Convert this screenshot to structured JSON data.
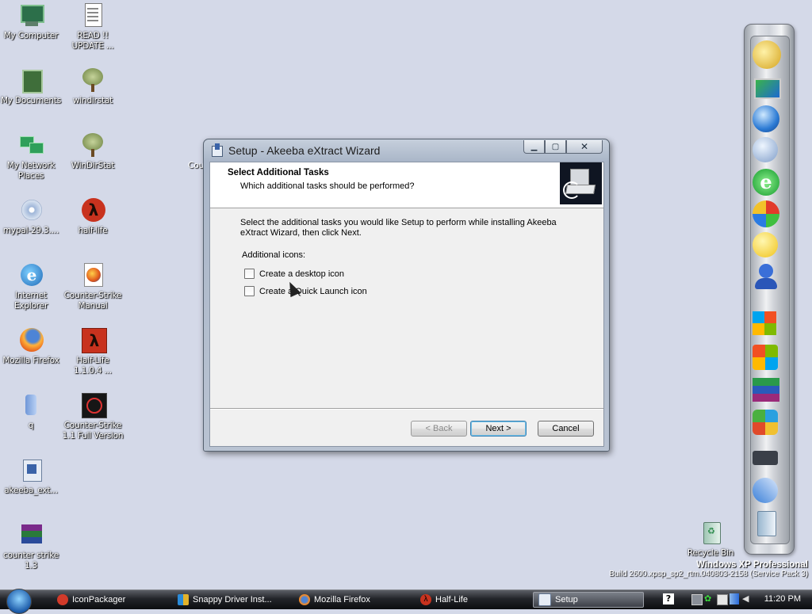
{
  "desktop": {
    "icons": [
      {
        "label": "My Computer"
      },
      {
        "label": "READ !! UPDATE ..."
      },
      {
        "label": "My Documents"
      },
      {
        "label": "windirstat"
      },
      {
        "label": "My Network Places"
      },
      {
        "label": "WinDirStat"
      },
      {
        "label": "mypal-29.3...."
      },
      {
        "label": "half-life"
      },
      {
        "label": "Internet Explorer"
      },
      {
        "label": "Counter-Strike Manual"
      },
      {
        "label": "Mozilla Firefox"
      },
      {
        "label": "Half-Life 1.1.0.4 ..."
      },
      {
        "label": "q"
      },
      {
        "label": "Counter-Strike 1.1 Full Version"
      },
      {
        "label": "akeeba_ext..."
      },
      {
        "label": "counter strike 1.3"
      },
      {
        "label": "Recycle Bin"
      }
    ],
    "partial_label": "Cou"
  },
  "window": {
    "title": "Setup - Akeeba eXtract Wizard",
    "header_title": "Select Additional Tasks",
    "header_subtitle": "Which additional tasks should be performed?",
    "intro": "Select the additional tasks you would like Setup to perform while installing Akeeba eXtract Wizard, then click Next.",
    "group_label": "Additional icons:",
    "tasks": [
      {
        "label": "Create a desktop icon",
        "checked": false
      },
      {
        "label": "Create a Quick Launch icon",
        "checked": false
      }
    ],
    "buttons": {
      "back": "< Back",
      "next": "Next >",
      "cancel": "Cancel"
    }
  },
  "taskbar": {
    "items": [
      {
        "label": "IconPackager",
        "icon": "iconpackager-icon"
      },
      {
        "label": "Snappy Driver Inst...",
        "icon": "snappy-icon"
      },
      {
        "label": "Mozilla Firefox",
        "icon": "firefox-icon"
      },
      {
        "label": "Half-Life",
        "icon": "halflife-icon"
      },
      {
        "label": "Setup",
        "icon": "setup-icon"
      }
    ],
    "clock": "11:20 PM"
  },
  "watermark": {
    "line1": "Windows XP Professional",
    "line2": "Build 2600.xpsp_sp2_rtm.040803-2158 (Service Pack 3)"
  }
}
